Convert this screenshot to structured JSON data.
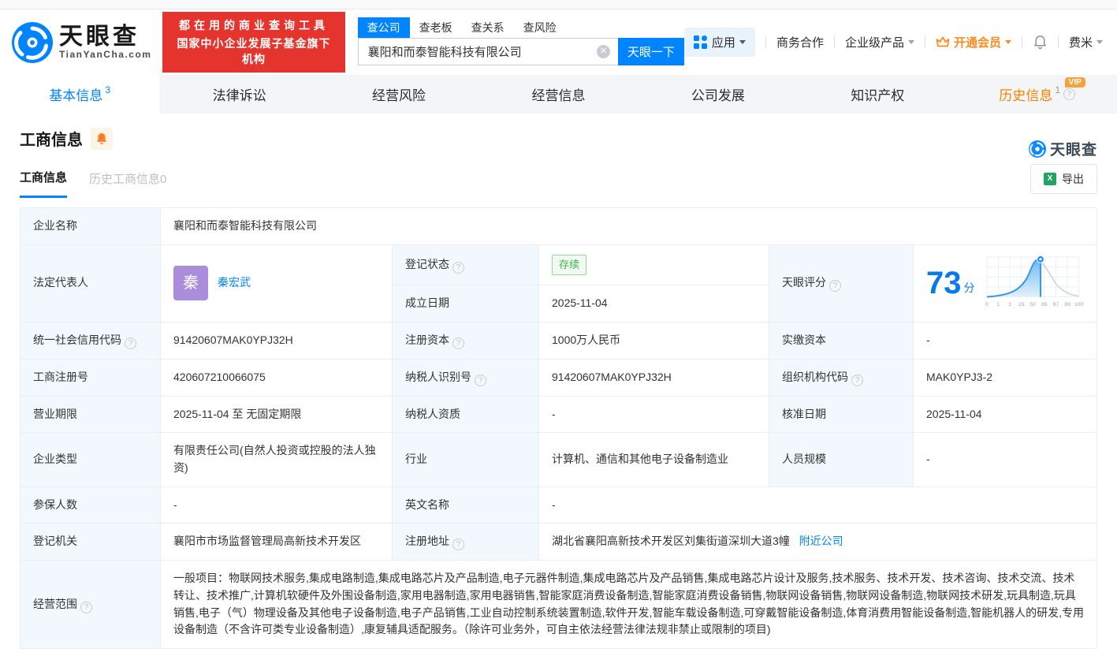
{
  "brand": {
    "name": "天眼查",
    "domain": "TianYanCha.com",
    "slogan_line1": "都在用的商业查询工具",
    "slogan_line2": "国家中小企业发展子基金旗下机构",
    "accent": "#0084ff",
    "red": "#e5332d"
  },
  "search": {
    "tabs": [
      "查公司",
      "查老板",
      "查关系",
      "查风险"
    ],
    "value": "襄阳和而泰智能科技有限公司",
    "clear": "✕",
    "button": "天眼一下"
  },
  "nav": {
    "apps": "应用",
    "biz": "商务合作",
    "enterprise": "企业级产品",
    "vip": "开通会员",
    "user": "费米"
  },
  "tabs": [
    {
      "label": "基本信息",
      "count": "3"
    },
    {
      "label": "法律诉讼"
    },
    {
      "label": "经营风险"
    },
    {
      "label": "经营信息"
    },
    {
      "label": "公司发展"
    },
    {
      "label": "知识产权"
    },
    {
      "label": "历史信息",
      "count": "1",
      "badge": "VIP",
      "help": "?"
    }
  ],
  "section": {
    "title": "工商信息",
    "watermark": "天眼查",
    "subtab_active": "工商信息",
    "subtab_history": "历史工商信息0",
    "export": "导出",
    "excel_icon": "X"
  },
  "help_glyph": "?",
  "info": {
    "name": {
      "label": "企业名称",
      "value": "襄阳和而泰智能科技有限公司"
    },
    "legal_rep": {
      "label": "法定代表人",
      "avatar": "秦",
      "value": "秦宏武"
    },
    "reg_status": {
      "label": "登记状态",
      "value": "存续"
    },
    "establish_date": {
      "label": "成立日期",
      "value": "2025-11-04"
    },
    "score": {
      "label": "天眼评分",
      "value": "73",
      "unit": "分"
    },
    "credit_code": {
      "label": "统一社会信用代码",
      "value": "91420607MAK0YPJ32H"
    },
    "reg_capital": {
      "label": "注册资本",
      "value": "1000万人民币"
    },
    "paid_capital": {
      "label": "实缴资本",
      "value": "-"
    },
    "reg_number": {
      "label": "工商注册号",
      "value": "420607210066075"
    },
    "taxpayer_id": {
      "label": "纳税人识别号",
      "value": "91420607MAK0YPJ32H"
    },
    "org_code": {
      "label": "组织机构代码",
      "value": "MAK0YPJ3-2"
    },
    "term": {
      "label": "营业期限",
      "value": "2025-11-04 至 无固定期限"
    },
    "taxpayer_cert": {
      "label": "纳税人资质",
      "value": "-"
    },
    "approval_date": {
      "label": "核准日期",
      "value": "2025-11-04"
    },
    "company_type": {
      "label": "企业类型",
      "value": "有限责任公司(自然人投资或控股的法人独资)"
    },
    "industry": {
      "label": "行业",
      "value": "计算机、通信和其他电子设备制造业"
    },
    "staff": {
      "label": "人员规模",
      "value": "-"
    },
    "insured": {
      "label": "参保人数",
      "value": "-"
    },
    "english_name": {
      "label": "英文名称",
      "value": "-"
    },
    "authority": {
      "label": "登记机关",
      "value": "襄阳市市场监督管理局高新技术开发区"
    },
    "address": {
      "label": "注册地址",
      "value": "湖北省襄阳高新技术开发区刘集街道深圳大道3幢",
      "link": "附近公司"
    },
    "scope": {
      "label": "经营范围",
      "value": "一般项目：物联网技术服务,集成电路制造,集成电路芯片及产品制造,电子元器件制造,集成电路芯片及产品销售,集成电路芯片设计及服务,技术服务、技术开发、技术咨询、技术交流、技术转让、技术推广,计算机软硬件及外围设备制造,家用电器制造,家用电器销售,智能家庭消费设备制造,智能家庭消费设备销售,物联网设备销售,物联网设备制造,物联网技术研发,玩具制造,玩具销售,电子（气）物理设备及其他电子设备制造,电子产品销售,工业自动控制系统装置制造,软件开发,智能车载设备制造,可穿戴智能设备制造,体育消费用智能设备制造,智能机器人的研发,专用设备制造（不含许可类专业设备制造）,康复辅具适配服务。（除许可业务外，可自主依法经营法律法规非禁止或限制的项目)"
    }
  },
  "score_chart": {
    "type": "area",
    "score": 73,
    "max": 100,
    "axis": [
      "0",
      "1",
      "3",
      "15",
      "50",
      "85",
      "97",
      "99",
      "100"
    ]
  }
}
